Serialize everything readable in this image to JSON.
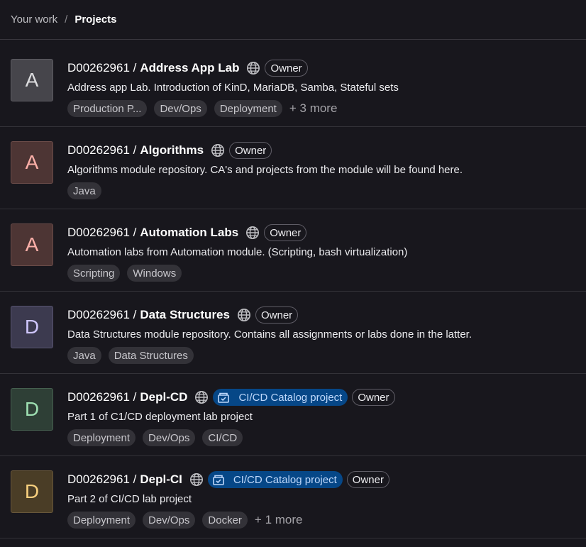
{
  "breadcrumb": {
    "parent": "Your work",
    "separator": "/",
    "current": "Projects"
  },
  "projects": [
    {
      "initial": "A",
      "namespace": "D00262961 /",
      "name": "Address App Lab",
      "catalog_badge": "",
      "role": "Owner",
      "description": "Address app Lab. Introduction of KinD, MariaDB, Samba, Stateful sets",
      "topics": [
        "Production P...",
        "Dev/Ops",
        "Deployment"
      ],
      "more": "+ 3 more",
      "avatar_bg": "#46454b",
      "avatar_fg": "#dcdcde",
      "avatar_border": "#5e5d63"
    },
    {
      "initial": "A",
      "namespace": "D00262961 /",
      "name": "Algorithms",
      "catalog_badge": "",
      "role": "Owner",
      "description": "Algorithms module repository. CA's and projects from the module will be found here.",
      "topics": [
        "Java"
      ],
      "more": "",
      "avatar_bg": "#4d3534",
      "avatar_fg": "#fdb0a9",
      "avatar_border": "#6b4c49"
    },
    {
      "initial": "A",
      "namespace": "D00262961 /",
      "name": "Automation Labs",
      "catalog_badge": "",
      "role": "Owner",
      "description": "Automation labs from Automation module. (Scripting, bash virtualization)",
      "topics": [
        "Scripting",
        "Windows"
      ],
      "more": "",
      "avatar_bg": "#4d3534",
      "avatar_fg": "#fdb0a9",
      "avatar_border": "#6b4c49"
    },
    {
      "initial": "D",
      "namespace": "D00262961 /",
      "name": "Data Structures",
      "catalog_badge": "",
      "role": "Owner",
      "description": "Data Structures module repository. Contains all assignments or labs done in the latter.",
      "topics": [
        "Java",
        "Data Structures"
      ],
      "more": "",
      "avatar_bg": "#3c3a4f",
      "avatar_fg": "#cfc6fc",
      "avatar_border": "#585470"
    },
    {
      "initial": "D",
      "namespace": "D00262961 /",
      "name": "Depl-CD",
      "catalog_badge": "CI/CD Catalog project",
      "role": "Owner",
      "description": "Part 1 of C1/CD deployment lab project",
      "topics": [
        "Deployment",
        "Dev/Ops",
        "CI/CD"
      ],
      "more": "",
      "avatar_bg": "#2e3f36",
      "avatar_fg": "#9edfb2",
      "avatar_border": "#466050"
    },
    {
      "initial": "D",
      "namespace": "D00262961 /",
      "name": "Depl-CI",
      "catalog_badge": "CI/CD Catalog project",
      "role": "Owner",
      "description": "Part 2 of CI/CD lab project",
      "topics": [
        "Deployment",
        "Dev/Ops",
        "Docker"
      ],
      "more": "+ 1 more",
      "avatar_bg": "#4a3d26",
      "avatar_fg": "#f7cf7e",
      "avatar_border": "#68573a"
    }
  ],
  "icons": {
    "visibility": "globe-icon",
    "catalog": "catalog-icon"
  }
}
